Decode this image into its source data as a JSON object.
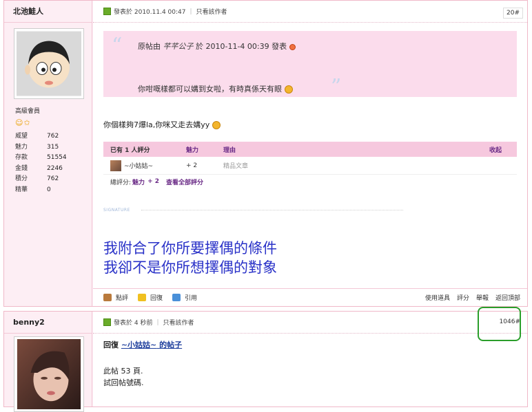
{
  "post1": {
    "username": "北池鮭人",
    "rank": "高級會員",
    "stats": [
      {
        "label": "威望",
        "value": "762"
      },
      {
        "label": "魅力",
        "value": "315"
      },
      {
        "label": "存款",
        "value": "51554"
      },
      {
        "label": "金錢",
        "value": "2246"
      },
      {
        "label": "積分",
        "value": "762"
      },
      {
        "label": "精華",
        "value": "0"
      }
    ],
    "posted_at": "發表於 2010.11.4 00:47",
    "author_only": "只看該作者",
    "floor": "20#",
    "quote_prefix": "原帖由",
    "quote_author": "芊芊公子",
    "quote_suffix": "於 2010-11-4 00:39 發表",
    "quote_text": "你咁嘅樣都可以媾到女啦，有時真係天有眼",
    "message": "你個樣夠7爆la,你咪又走去媾yy",
    "rating_header": "已有 1 人評分",
    "rating_col_charm": "魅力",
    "rating_col_reason": "理由",
    "rating_collapse": "收起",
    "rating_user": "~小姑姑~",
    "rating_value": "+ 2",
    "rating_reason": "精品文章",
    "rating_total_prefix": "總評分:",
    "rating_total_charm": "魅力",
    "rating_total_value": "+ 2",
    "rating_view_all": "查看全部評分",
    "signature_label": "SIGNATURE",
    "signature_line1": "我附合了你所要擇偶的條件",
    "signature_line2": "我卻不是你所想擇偶的對象",
    "actions": [
      "點評",
      "回復",
      "引用"
    ],
    "right_actions": [
      "使用道具",
      "評分",
      "舉報",
      "返回頂部"
    ]
  },
  "post2": {
    "username": "benny2",
    "posted_at": "發表於 4 秒前",
    "author_only": "只看該作者",
    "floor": "1046#",
    "reply_prefix": "回復",
    "reply_link_user": "~小姑姑~",
    "reply_link_suffix": "的帖子",
    "body_line1": "此帖 53 頁.",
    "body_line2": "試回帖號碼."
  },
  "colors": {
    "accent": "#f6c8de",
    "signature": "#2a32c8",
    "highlight": "#2a9e2a"
  }
}
